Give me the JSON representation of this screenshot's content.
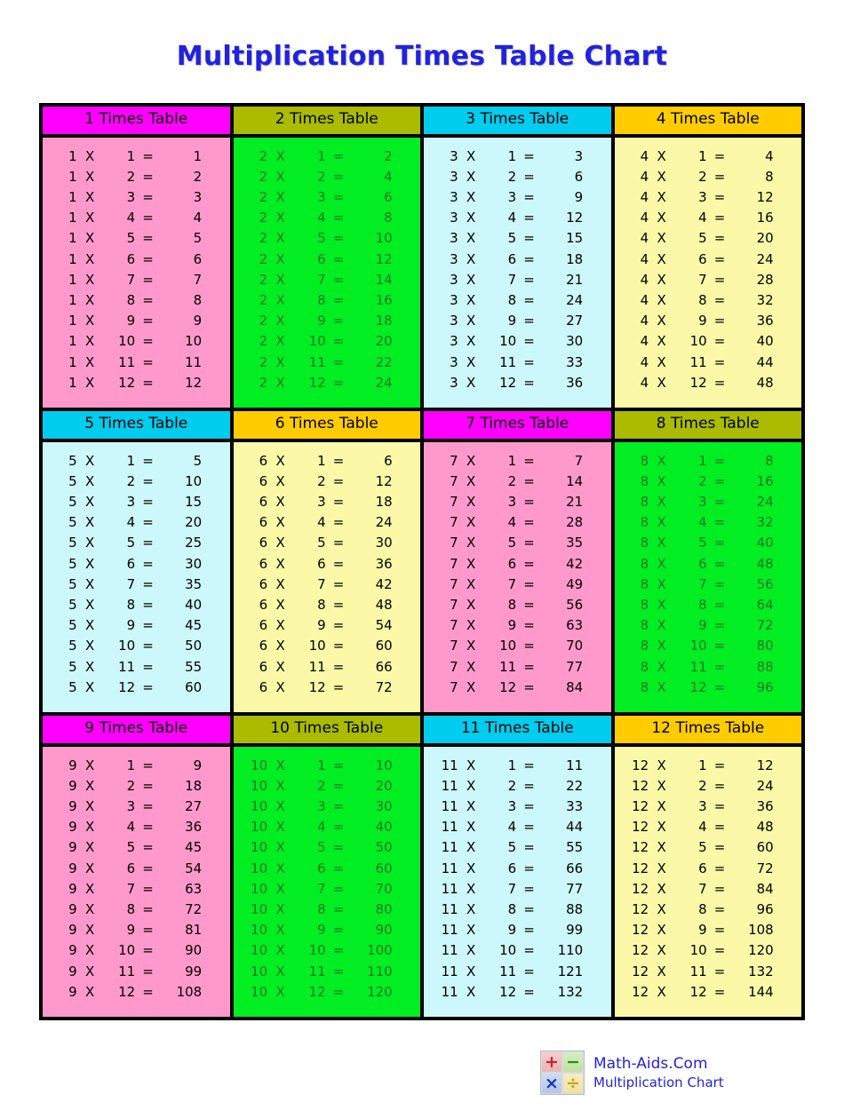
{
  "page": {
    "title": "Multiplication Times Table Chart",
    "title_color": "#2222dd"
  },
  "symbols": {
    "multiply": "X",
    "equals": "="
  },
  "tables": [
    {
      "heading": "1 Times Table",
      "header_bg": "#ff00ff",
      "header_fg": "#000000",
      "body_bg": "#ff99cc",
      "body_fg": "#000000",
      "rows": [
        {
          "a": "1",
          "b": "1",
          "result": "1"
        },
        {
          "a": "1",
          "b": "2",
          "result": "2"
        },
        {
          "a": "1",
          "b": "3",
          "result": "3"
        },
        {
          "a": "1",
          "b": "4",
          "result": "4"
        },
        {
          "a": "1",
          "b": "5",
          "result": "5"
        },
        {
          "a": "1",
          "b": "6",
          "result": "6"
        },
        {
          "a": "1",
          "b": "7",
          "result": "7"
        },
        {
          "a": "1",
          "b": "8",
          "result": "8"
        },
        {
          "a": "1",
          "b": "9",
          "result": "9"
        },
        {
          "a": "1",
          "b": "10",
          "result": "10"
        },
        {
          "a": "1",
          "b": "11",
          "result": "11"
        },
        {
          "a": "1",
          "b": "12",
          "result": "12"
        }
      ]
    },
    {
      "heading": "2 Times Table",
      "header_bg": "#aabb00",
      "header_fg": "#000000",
      "body_bg": "#00ee22",
      "body_fg": "#117722",
      "rows": [
        {
          "a": "2",
          "b": "1",
          "result": "2"
        },
        {
          "a": "2",
          "b": "2",
          "result": "4"
        },
        {
          "a": "2",
          "b": "3",
          "result": "6"
        },
        {
          "a": "2",
          "b": "4",
          "result": "8"
        },
        {
          "a": "2",
          "b": "5",
          "result": "10"
        },
        {
          "a": "2",
          "b": "6",
          "result": "12"
        },
        {
          "a": "2",
          "b": "7",
          "result": "14"
        },
        {
          "a": "2",
          "b": "8",
          "result": "16"
        },
        {
          "a": "2",
          "b": "9",
          "result": "18"
        },
        {
          "a": "2",
          "b": "10",
          "result": "20"
        },
        {
          "a": "2",
          "b": "11",
          "result": "22"
        },
        {
          "a": "2",
          "b": "12",
          "result": "24"
        }
      ]
    },
    {
      "heading": "3 Times Table",
      "header_bg": "#00ccee",
      "header_fg": "#000000",
      "body_bg": "#ccf7fb",
      "body_fg": "#000000",
      "rows": [
        {
          "a": "3",
          "b": "1",
          "result": "3"
        },
        {
          "a": "3",
          "b": "2",
          "result": "6"
        },
        {
          "a": "3",
          "b": "3",
          "result": "9"
        },
        {
          "a": "3",
          "b": "4",
          "result": "12"
        },
        {
          "a": "3",
          "b": "5",
          "result": "15"
        },
        {
          "a": "3",
          "b": "6",
          "result": "18"
        },
        {
          "a": "3",
          "b": "7",
          "result": "21"
        },
        {
          "a": "3",
          "b": "8",
          "result": "24"
        },
        {
          "a": "3",
          "b": "9",
          "result": "27"
        },
        {
          "a": "3",
          "b": "10",
          "result": "30"
        },
        {
          "a": "3",
          "b": "11",
          "result": "33"
        },
        {
          "a": "3",
          "b": "12",
          "result": "36"
        }
      ]
    },
    {
      "heading": "4 Times Table",
      "header_bg": "#ffcc00",
      "header_fg": "#000000",
      "body_bg": "#fbf9a8",
      "body_fg": "#000000",
      "rows": [
        {
          "a": "4",
          "b": "1",
          "result": "4"
        },
        {
          "a": "4",
          "b": "2",
          "result": "8"
        },
        {
          "a": "4",
          "b": "3",
          "result": "12"
        },
        {
          "a": "4",
          "b": "4",
          "result": "16"
        },
        {
          "a": "4",
          "b": "5",
          "result": "20"
        },
        {
          "a": "4",
          "b": "6",
          "result": "24"
        },
        {
          "a": "4",
          "b": "7",
          "result": "28"
        },
        {
          "a": "4",
          "b": "8",
          "result": "32"
        },
        {
          "a": "4",
          "b": "9",
          "result": "36"
        },
        {
          "a": "4",
          "b": "10",
          "result": "40"
        },
        {
          "a": "4",
          "b": "11",
          "result": "44"
        },
        {
          "a": "4",
          "b": "12",
          "result": "48"
        }
      ]
    },
    {
      "heading": "5 Times Table",
      "header_bg": "#00ccee",
      "header_fg": "#000000",
      "body_bg": "#ccf7fb",
      "body_fg": "#000000",
      "rows": [
        {
          "a": "5",
          "b": "1",
          "result": "5"
        },
        {
          "a": "5",
          "b": "2",
          "result": "10"
        },
        {
          "a": "5",
          "b": "3",
          "result": "15"
        },
        {
          "a": "5",
          "b": "4",
          "result": "20"
        },
        {
          "a": "5",
          "b": "5",
          "result": "25"
        },
        {
          "a": "5",
          "b": "6",
          "result": "30"
        },
        {
          "a": "5",
          "b": "7",
          "result": "35"
        },
        {
          "a": "5",
          "b": "8",
          "result": "40"
        },
        {
          "a": "5",
          "b": "9",
          "result": "45"
        },
        {
          "a": "5",
          "b": "10",
          "result": "50"
        },
        {
          "a": "5",
          "b": "11",
          "result": "55"
        },
        {
          "a": "5",
          "b": "12",
          "result": "60"
        }
      ]
    },
    {
      "heading": "6 Times Table",
      "header_bg": "#ffcc00",
      "header_fg": "#000000",
      "body_bg": "#fbf9a8",
      "body_fg": "#000000",
      "rows": [
        {
          "a": "6",
          "b": "1",
          "result": "6"
        },
        {
          "a": "6",
          "b": "2",
          "result": "12"
        },
        {
          "a": "6",
          "b": "3",
          "result": "18"
        },
        {
          "a": "6",
          "b": "4",
          "result": "24"
        },
        {
          "a": "6",
          "b": "5",
          "result": "30"
        },
        {
          "a": "6",
          "b": "6",
          "result": "36"
        },
        {
          "a": "6",
          "b": "7",
          "result": "42"
        },
        {
          "a": "6",
          "b": "8",
          "result": "48"
        },
        {
          "a": "6",
          "b": "9",
          "result": "54"
        },
        {
          "a": "6",
          "b": "10",
          "result": "60"
        },
        {
          "a": "6",
          "b": "11",
          "result": "66"
        },
        {
          "a": "6",
          "b": "12",
          "result": "72"
        }
      ]
    },
    {
      "heading": "7 Times Table",
      "header_bg": "#ff00ff",
      "header_fg": "#000000",
      "body_bg": "#ff99cc",
      "body_fg": "#000000",
      "rows": [
        {
          "a": "7",
          "b": "1",
          "result": "7"
        },
        {
          "a": "7",
          "b": "2",
          "result": "14"
        },
        {
          "a": "7",
          "b": "3",
          "result": "21"
        },
        {
          "a": "7",
          "b": "4",
          "result": "28"
        },
        {
          "a": "7",
          "b": "5",
          "result": "35"
        },
        {
          "a": "7",
          "b": "6",
          "result": "42"
        },
        {
          "a": "7",
          "b": "7",
          "result": "49"
        },
        {
          "a": "7",
          "b": "8",
          "result": "56"
        },
        {
          "a": "7",
          "b": "9",
          "result": "63"
        },
        {
          "a": "7",
          "b": "10",
          "result": "70"
        },
        {
          "a": "7",
          "b": "11",
          "result": "77"
        },
        {
          "a": "7",
          "b": "12",
          "result": "84"
        }
      ]
    },
    {
      "heading": "8 Times Table",
      "header_bg": "#aabb00",
      "header_fg": "#000000",
      "body_bg": "#00ee22",
      "body_fg": "#117722",
      "rows": [
        {
          "a": "8",
          "b": "1",
          "result": "8"
        },
        {
          "a": "8",
          "b": "2",
          "result": "16"
        },
        {
          "a": "8",
          "b": "3",
          "result": "24"
        },
        {
          "a": "8",
          "b": "4",
          "result": "32"
        },
        {
          "a": "8",
          "b": "5",
          "result": "40"
        },
        {
          "a": "8",
          "b": "6",
          "result": "48"
        },
        {
          "a": "8",
          "b": "7",
          "result": "56"
        },
        {
          "a": "8",
          "b": "8",
          "result": "64"
        },
        {
          "a": "8",
          "b": "9",
          "result": "72"
        },
        {
          "a": "8",
          "b": "10",
          "result": "80"
        },
        {
          "a": "8",
          "b": "11",
          "result": "88"
        },
        {
          "a": "8",
          "b": "12",
          "result": "96"
        }
      ]
    },
    {
      "heading": "9 Times Table",
      "header_bg": "#ff00ff",
      "header_fg": "#000000",
      "body_bg": "#ff99cc",
      "body_fg": "#000000",
      "rows": [
        {
          "a": "9",
          "b": "1",
          "result": "9"
        },
        {
          "a": "9",
          "b": "2",
          "result": "18"
        },
        {
          "a": "9",
          "b": "3",
          "result": "27"
        },
        {
          "a": "9",
          "b": "4",
          "result": "36"
        },
        {
          "a": "9",
          "b": "5",
          "result": "45"
        },
        {
          "a": "9",
          "b": "6",
          "result": "54"
        },
        {
          "a": "9",
          "b": "7",
          "result": "63"
        },
        {
          "a": "9",
          "b": "8",
          "result": "72"
        },
        {
          "a": "9",
          "b": "9",
          "result": "81"
        },
        {
          "a": "9",
          "b": "10",
          "result": "90"
        },
        {
          "a": "9",
          "b": "11",
          "result": "99"
        },
        {
          "a": "9",
          "b": "12",
          "result": "108"
        }
      ]
    },
    {
      "heading": "10 Times Table",
      "header_bg": "#aabb00",
      "header_fg": "#000000",
      "body_bg": "#00ee22",
      "body_fg": "#117722",
      "rows": [
        {
          "a": "10",
          "b": "1",
          "result": "10"
        },
        {
          "a": "10",
          "b": "2",
          "result": "20"
        },
        {
          "a": "10",
          "b": "3",
          "result": "30"
        },
        {
          "a": "10",
          "b": "4",
          "result": "40"
        },
        {
          "a": "10",
          "b": "5",
          "result": "50"
        },
        {
          "a": "10",
          "b": "6",
          "result": "60"
        },
        {
          "a": "10",
          "b": "7",
          "result": "70"
        },
        {
          "a": "10",
          "b": "8",
          "result": "80"
        },
        {
          "a": "10",
          "b": "9",
          "result": "90"
        },
        {
          "a": "10",
          "b": "10",
          "result": "100"
        },
        {
          "a": "10",
          "b": "11",
          "result": "110"
        },
        {
          "a": "10",
          "b": "12",
          "result": "120"
        }
      ]
    },
    {
      "heading": "11 Times Table",
      "header_bg": "#00ccee",
      "header_fg": "#000000",
      "body_bg": "#ccf7fb",
      "body_fg": "#000000",
      "rows": [
        {
          "a": "11",
          "b": "1",
          "result": "11"
        },
        {
          "a": "11",
          "b": "2",
          "result": "22"
        },
        {
          "a": "11",
          "b": "3",
          "result": "33"
        },
        {
          "a": "11",
          "b": "4",
          "result": "44"
        },
        {
          "a": "11",
          "b": "5",
          "result": "55"
        },
        {
          "a": "11",
          "b": "6",
          "result": "66"
        },
        {
          "a": "11",
          "b": "7",
          "result": "77"
        },
        {
          "a": "11",
          "b": "8",
          "result": "88"
        },
        {
          "a": "11",
          "b": "9",
          "result": "99"
        },
        {
          "a": "11",
          "b": "10",
          "result": "110"
        },
        {
          "a": "11",
          "b": "11",
          "result": "121"
        },
        {
          "a": "11",
          "b": "12",
          "result": "132"
        }
      ]
    },
    {
      "heading": "12 Times Table",
      "header_bg": "#ffcc00",
      "header_fg": "#000000",
      "body_bg": "#fbf9a8",
      "body_fg": "#000000",
      "rows": [
        {
          "a": "12",
          "b": "1",
          "result": "12"
        },
        {
          "a": "12",
          "b": "2",
          "result": "24"
        },
        {
          "a": "12",
          "b": "3",
          "result": "36"
        },
        {
          "a": "12",
          "b": "4",
          "result": "48"
        },
        {
          "a": "12",
          "b": "5",
          "result": "60"
        },
        {
          "a": "12",
          "b": "6",
          "result": "72"
        },
        {
          "a": "12",
          "b": "7",
          "result": "84"
        },
        {
          "a": "12",
          "b": "8",
          "result": "96"
        },
        {
          "a": "12",
          "b": "9",
          "result": "108"
        },
        {
          "a": "12",
          "b": "10",
          "result": "120"
        },
        {
          "a": "12",
          "b": "11",
          "result": "132"
        },
        {
          "a": "12",
          "b": "12",
          "result": "144"
        }
      ]
    }
  ],
  "footer": {
    "brand": "Math-Aids.Com",
    "subtitle": "Multiplication Chart",
    "brand_color": "#2222dd",
    "logo": {
      "plus": "+",
      "minus": "−",
      "times": "×",
      "divide": "÷"
    }
  }
}
